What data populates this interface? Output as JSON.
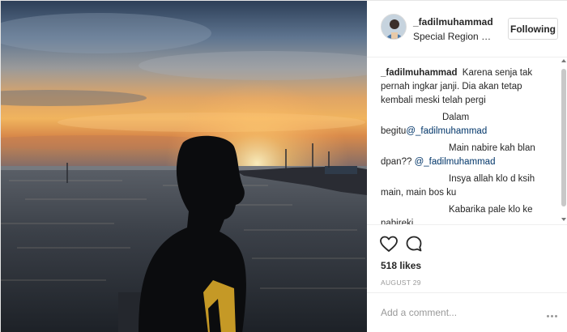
{
  "post": {
    "username": "_fadilmuhammad",
    "location": "Special Region of Yogyakarta",
    "follow_label": "Following"
  },
  "comments": [
    {
      "user": "_fadilmuhammad",
      "text": "Karena senja tak pernah ingkar janji. Dia akan tetap kembali meski telah pergi"
    },
    {
      "line1": "Dalam",
      "line2": "begitu",
      "mention": "@_fadilmuhammad"
    },
    {
      "line1": "Main nabire kah blan",
      "line2": "dpan?? ",
      "mention": "@_fadilmuhammad"
    },
    {
      "line1": "Insya allah klo d ksih",
      "line2": "main, main bos ku"
    },
    {
      "line1": "Kabarika pale klo ke",
      "line2": "nabireki"
    }
  ],
  "actions": {
    "likes": "518 likes",
    "date": "AUGUST 29"
  },
  "add_comment": {
    "placeholder": "Add a comment..."
  },
  "icons": {
    "like": "heart-icon",
    "comment": "speech-bubble-icon",
    "more": "more-options-icon"
  },
  "colors": {
    "text": "#262626",
    "muted": "#999999",
    "mention": "#003569",
    "border": "#efefef"
  }
}
